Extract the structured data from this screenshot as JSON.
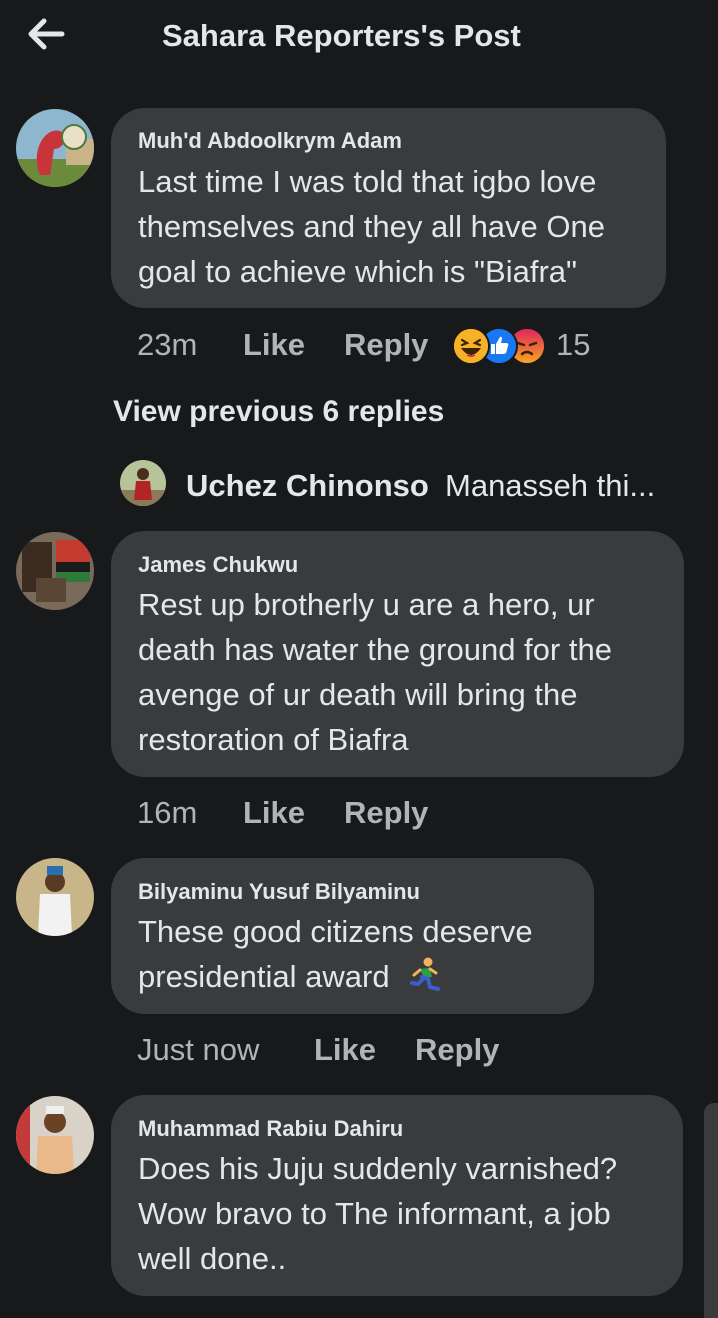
{
  "header": {
    "title": "Sahara Reporters's Post",
    "back_icon": "arrow-left-icon"
  },
  "comments": [
    {
      "author": "Muh'd Abdoolkrym Adam",
      "lines": [
        "Last time I was told that igbo love",
        "themselves and they all have One",
        "goal to achieve which is \"Biafra\""
      ],
      "time": "23m",
      "like": "Like",
      "reply": "Reply",
      "reactions": {
        "icons": [
          "haha-icon",
          "like-icon",
          "angry-icon"
        ],
        "count": "15"
      }
    },
    {
      "author": "James Chukwu",
      "lines": [
        "Rest up brotherly u are a hero, ur",
        "death has water the ground for the",
        "avenge of ur death will bring the",
        "restoration of Biafra"
      ],
      "time": "16m",
      "like": "Like",
      "reply": "Reply"
    },
    {
      "author": "Bilyaminu Yusuf Bilyaminu",
      "lines": [
        "These good citizens deserve",
        "presidential award"
      ],
      "emoji": "running-man-emoji",
      "time": "Just now",
      "like": "Like",
      "reply": "Reply"
    },
    {
      "author": "Muhammad Rabiu Dahiru",
      "lines": [
        "Does his Juju suddenly varnished?",
        "Wow bravo to The informant, a job",
        "well done.."
      ]
    }
  ],
  "view_previous": "View previous 6 replies",
  "reply_preview": {
    "name": "Uchez Chinonso",
    "text": "Manasseh thi..."
  },
  "colors": {
    "background": "#18191a",
    "bubble": "#3a3b3c",
    "primary_text": "#e4e6eb",
    "secondary_text": "#b0b3b8",
    "like_blue": "#1877f2",
    "haha_yellow": "#f7b125",
    "angry_orange": "#e9710f"
  }
}
